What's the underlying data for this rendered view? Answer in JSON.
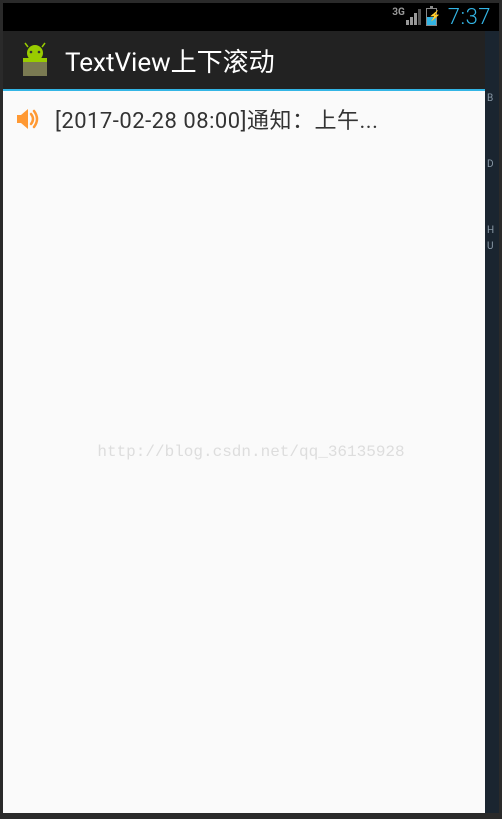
{
  "statusBar": {
    "networkType": "3G",
    "clock": "7:37"
  },
  "actionBar": {
    "title": "TextView上下滚动"
  },
  "notification": {
    "text": "[2017-02-28  08:00]通知：上午..."
  },
  "watermark": "http://blog.csdn.net/qq_36135928",
  "drawer": {
    "label1": "B",
    "label2": "D",
    "label3": "H",
    "label4": "U"
  }
}
